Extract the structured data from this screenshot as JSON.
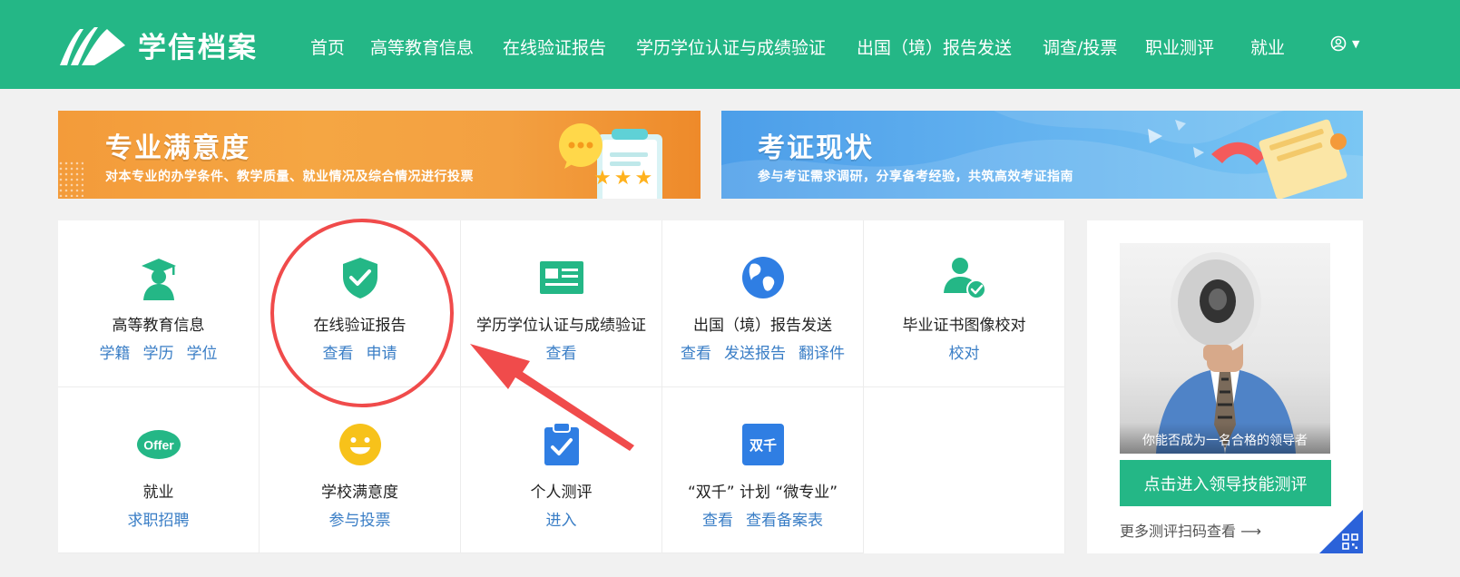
{
  "header": {
    "logo_text": "学信档案",
    "nav": [
      "首页",
      "高等教育信息",
      "在线验证报告",
      "学历学位认证与成绩验证",
      "出国（境）报告发送",
      "调查/投票",
      "职业测评",
      "就业"
    ],
    "user_icon": "user-circle-icon",
    "accent_color": "#24b786"
  },
  "banners": {
    "left": {
      "title": "专业满意度",
      "subtitle": "对本专业的办学条件、教学质量、就业情况及综合情况进行投票",
      "stars": "★★★"
    },
    "right": {
      "title": "考证现状",
      "subtitle": "参与考证需求调研，分享备考经验，共筑高效考证指南"
    }
  },
  "services": [
    {
      "title": "高等教育信息",
      "icon": "graduate-icon",
      "links": [
        "学籍",
        "学历",
        "学位"
      ]
    },
    {
      "title": "在线验证报告",
      "icon": "shield-check-icon",
      "links": [
        "查看",
        "申请"
      ]
    },
    {
      "title": "学历学位认证与成绩验证",
      "icon": "id-card-icon",
      "links": [
        "查看"
      ]
    },
    {
      "title": "出国（境）报告发送",
      "icon": "globe-icon",
      "links": [
        "查看",
        "发送报告",
        "翻译件"
      ]
    },
    {
      "title": "毕业证书图像校对",
      "icon": "user-check-icon",
      "links": [
        "校对"
      ]
    },
    {
      "title": "就业",
      "icon": "offer-icon",
      "icon_text": "Offer",
      "links": [
        "求职招聘"
      ]
    },
    {
      "title": "学校满意度",
      "icon": "smiley-icon",
      "links": [
        "参与投票"
      ]
    },
    {
      "title": "个人测评",
      "icon": "clipboard-check-icon",
      "links": [
        "进入"
      ]
    },
    {
      "title": "“双千” 计划 “微专业”",
      "icon": "shuangqian-icon",
      "icon_text": "双千",
      "links": [
        "查看",
        "查看备案表"
      ]
    }
  ],
  "side": {
    "caption": "你能否成为一名合格的领导者",
    "button": "点击进入领导技能测评",
    "more": "更多测评扫码查看 ⟶",
    "qr_icon": "qr-code-icon"
  }
}
